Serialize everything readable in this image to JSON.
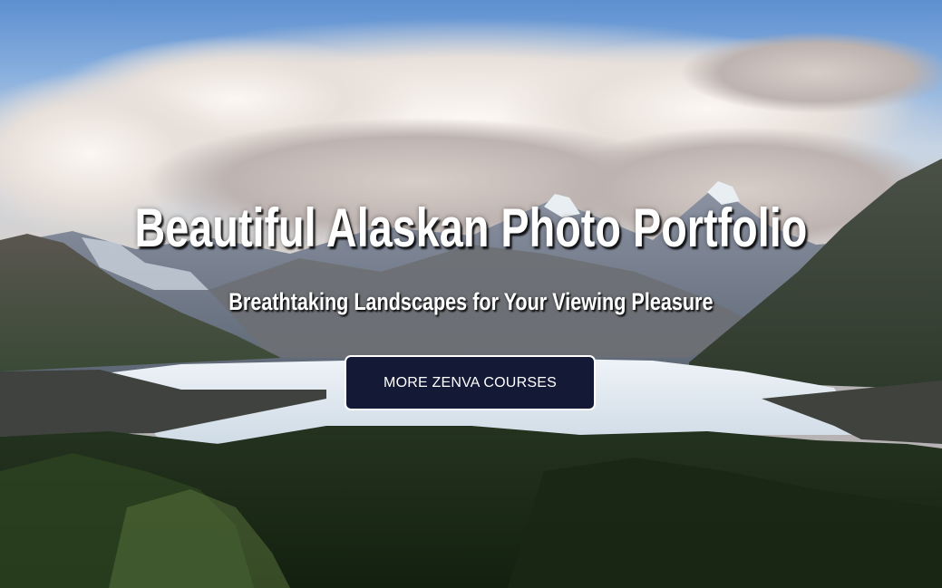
{
  "hero": {
    "title": "Beautiful Alaskan Photo Portfolio",
    "subtitle": "Breathtaking Landscapes for Your Viewing Pleasure",
    "cta_label": "MORE ZENVA COURSES"
  },
  "colors": {
    "button_bg": "#141a36",
    "button_border": "#ffffff",
    "text": "#ffffff"
  }
}
